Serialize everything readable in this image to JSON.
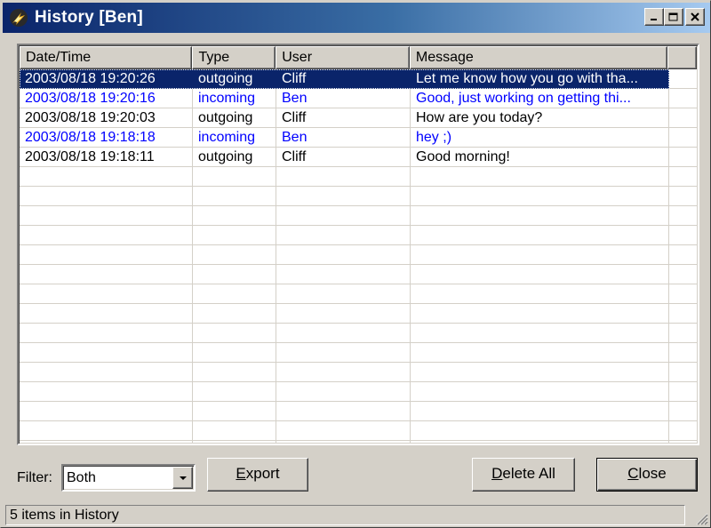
{
  "window": {
    "title": "History [Ben]"
  },
  "icons": {
    "app": "flame-app-icon",
    "minimize": "minimize-icon",
    "maximize": "maximize-icon",
    "close": "close-icon",
    "dropdown": "chevron-down-icon",
    "grip": "resize-grip-icon"
  },
  "colors": {
    "titlebar_start": "#0a246a",
    "titlebar_end": "#a6caf0",
    "selected_bg": "#0a246a",
    "incoming_text": "#0000ff",
    "outgoing_text": "#000000"
  },
  "table": {
    "columns": [
      "Date/Time",
      "Type",
      "User",
      "Message"
    ],
    "rows": [
      {
        "datetime": "2003/08/18 19:20:26",
        "type": "outgoing",
        "user": "Cliff",
        "message": "Let me know how you go with tha...",
        "selected": true
      },
      {
        "datetime": "2003/08/18 19:20:16",
        "type": "incoming",
        "user": "Ben",
        "message": "Good, just working on getting thi...",
        "selected": false
      },
      {
        "datetime": "2003/08/18 19:20:03",
        "type": "outgoing",
        "user": "Cliff",
        "message": "How are you today?",
        "selected": false
      },
      {
        "datetime": "2003/08/18 19:18:18",
        "type": "incoming",
        "user": "Ben",
        "message": "hey ;)",
        "selected": false
      },
      {
        "datetime": "2003/08/18 19:18:11",
        "type": "outgoing",
        "user": "Cliff",
        "message": "Good morning!",
        "selected": false
      }
    ]
  },
  "filter": {
    "label": "Filter:",
    "value": "Both"
  },
  "buttons": {
    "export_pre": "",
    "export_key": "E",
    "export_post": "xport",
    "delete_pre": "",
    "delete_key": "D",
    "delete_post": "elete All",
    "close_pre": "",
    "close_key": "C",
    "close_post": "lose"
  },
  "status": {
    "text": "5 items in History"
  }
}
